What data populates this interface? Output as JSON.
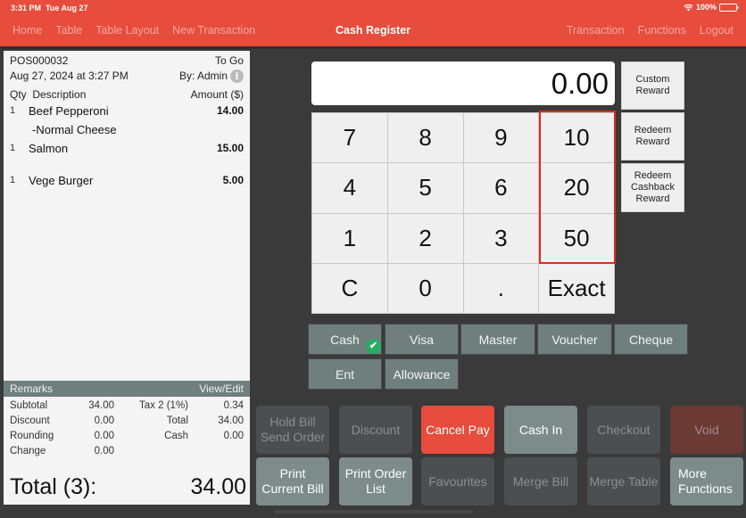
{
  "status_bar": {
    "time": "3:31 PM",
    "date": "Tue Aug 27",
    "battery": "100%"
  },
  "nav": {
    "left": [
      "Home",
      "Table",
      "Table Layout",
      "New Transaction"
    ],
    "title": "Cash Register",
    "right": [
      "Transaction",
      "Functions",
      "Logout"
    ]
  },
  "receipt": {
    "order_no": "POS000032",
    "order_type": "To Go",
    "datetime": "Aug 27, 2024 at 3:27 PM",
    "by": "By: Admin",
    "headers": {
      "qty": "Qty",
      "description": "Description",
      "amount": "Amount ($)"
    },
    "items": [
      {
        "qty": "1",
        "description": "Beef Pepperoni",
        "amount": "14.00"
      },
      {
        "qty": "",
        "description": "-Normal Cheese",
        "amount": ""
      },
      {
        "qty": "1",
        "description": "Salmon",
        "amount": "15.00"
      },
      {
        "qty": "1",
        "description": "Vege Burger",
        "amount": "5.00"
      }
    ],
    "remarks_label": "Remarks",
    "remarks_action": "View/Edit",
    "summary": [
      {
        "label": "Subtotal",
        "value": "34.00",
        "label2": "Tax 2 (1%)",
        "value2": "0.34"
      },
      {
        "label": "Discount",
        "value": "0.00",
        "label2": "Total",
        "value2": "34.00"
      },
      {
        "label": "Rounding",
        "value": "0.00",
        "label2": "Cash",
        "value2": "0.00"
      },
      {
        "label": "Change",
        "value": "0.00",
        "label2": "",
        "value2": ""
      }
    ],
    "grand_total_label": "Total (3):",
    "grand_total_value": "34.00"
  },
  "keypad": {
    "display": "0.00",
    "keys": [
      "7",
      "8",
      "9",
      "10",
      "4",
      "5",
      "6",
      "20",
      "1",
      "2",
      "3",
      "50",
      "C",
      "0",
      ".",
      "Exact"
    ]
  },
  "rewards": [
    "Custom Reward",
    "Redeem Reward",
    "Redeem Cashback Reward"
  ],
  "payment_methods": {
    "items": [
      "Cash",
      "Visa",
      "Master",
      "Voucher",
      "Cheque",
      "Ent",
      "Allowance"
    ],
    "selected": "Cash"
  },
  "actions": [
    {
      "label": "Hold Bill Send Order",
      "state": "disabled"
    },
    {
      "label": "Discount",
      "state": "disabled"
    },
    {
      "label": "Cancel Pay",
      "state": "primary"
    },
    {
      "label": "Cash In",
      "state": "enabled"
    },
    {
      "label": "Checkout",
      "state": "disabled"
    },
    {
      "label": "Void",
      "state": "disabled"
    },
    {
      "label": "Print Current Bill",
      "state": "enabled"
    },
    {
      "label": "Print Order List",
      "state": "enabled"
    },
    {
      "label": "Favourites",
      "state": "disabled"
    },
    {
      "label": "Merge Bill",
      "state": "disabled"
    },
    {
      "label": "Merge Table",
      "state": "disabled"
    },
    {
      "label": "More Functions",
      "state": "enabled"
    }
  ],
  "colors": {
    "brand": "#e74c3c",
    "pay_method": "#6f7f7d",
    "selected_check": "#27ae60",
    "quick_amount_outline": "#e02a20"
  }
}
